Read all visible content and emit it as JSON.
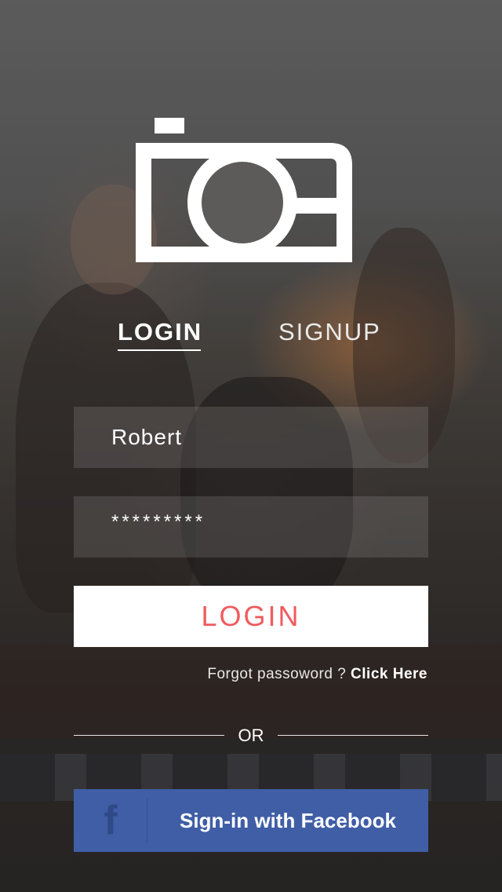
{
  "tabs": {
    "login": "LOGIN",
    "signup": "SIGNUP"
  },
  "form": {
    "username_value": "Robert",
    "password_value": "*********"
  },
  "login_button": "LOGIN",
  "forgot": {
    "text": "Forgot passoword ?",
    "link": "Click Here"
  },
  "divider": {
    "or": "OR"
  },
  "facebook": {
    "icon": "f",
    "label": "Sign-in with Facebook"
  },
  "colors": {
    "accent": "#ef5b5f",
    "facebook": "#3f5ea6"
  }
}
